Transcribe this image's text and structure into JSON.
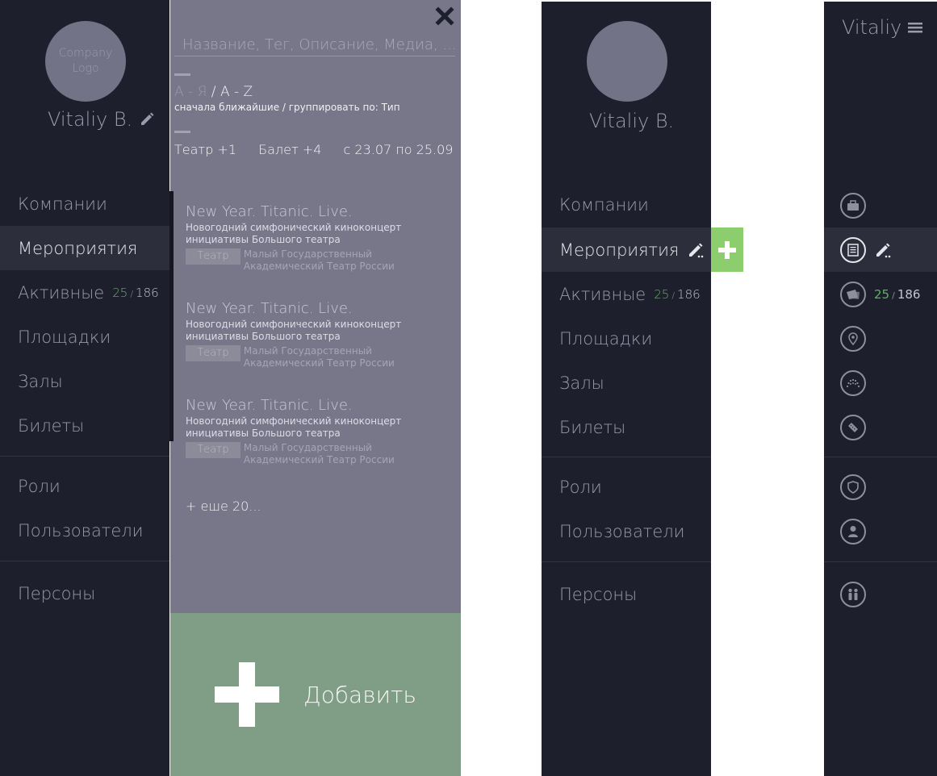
{
  "sidebar_full": {
    "logo_text": "Company Logo",
    "user_name": "Vitaliy B.",
    "nav": {
      "companies": "Компании",
      "events": "Мероприятия",
      "active": "Активные",
      "venues": "Площадки",
      "halls": "Залы",
      "tickets": "Билеты",
      "roles": "Роли",
      "users": "Пользователи",
      "persons": "Персоны"
    },
    "active_count": "25",
    "total_count": "186",
    "count_sep": "/"
  },
  "panel": {
    "search_placeholder": "Название, Тег, Описание, Медиа, ...",
    "sort_dim": "А - Я",
    "sort_sep": " / ",
    "sort_active": "A - Z",
    "sort_sub": "сначала ближайшие / группировать по: Тип",
    "filters": [
      "Театр +1",
      "Балет +4",
      "с 23.07 по 25.09"
    ],
    "events": [
      {
        "title": "New Year. Titanic. Live.",
        "desc": "Новогодний симфонический киноконцерт инициативы Большого театра",
        "tag": "Театр",
        "venue": "Малый Государственный Академический Театр России"
      },
      {
        "title": "New Year. Titanic. Live.",
        "desc": "Новогодний симфонический киноконцерт инициативы Большого театра",
        "tag": "Театр",
        "venue": "Малый Государственный Академический Театр России"
      },
      {
        "title": "New Year. Titanic. Live.",
        "desc": "Новогодний симфонический киноконцерт инициативы Большого театра",
        "tag": "Театр",
        "venue": "Малый Государственный Академический Театр России"
      }
    ],
    "more": "+ еше 20...",
    "add_label": "Добавить"
  },
  "sidebar_edit": {
    "user_name": "Vitaliy B.",
    "nav": {
      "companies": "Компании",
      "events": "Мероприятия",
      "active": "Активные",
      "venues": "Площадки",
      "halls": "Залы",
      "tickets": "Билеты",
      "roles": "Роли",
      "users": "Пользователи",
      "persons": "Персоны"
    },
    "active_count": "25",
    "total_count": "186",
    "count_sep": "/"
  },
  "sidebar_compact": {
    "user_name": "Vitaliy",
    "active_count": "25",
    "total_count": "186",
    "count_sep": "/",
    "icons": [
      "briefcase-icon",
      "document-icon",
      "tickets-icon",
      "location-pin-icon",
      "hall-icon",
      "ticket-icon",
      "shield-icon",
      "person-icon",
      "persons-icon"
    ]
  },
  "colors": {
    "sidebar_bg": "#1e1f2c",
    "panel_bg": "#787689",
    "add_bg": "#7f9e85",
    "accent_green": "#8ccd6e",
    "count_green": "#5bb55b"
  }
}
